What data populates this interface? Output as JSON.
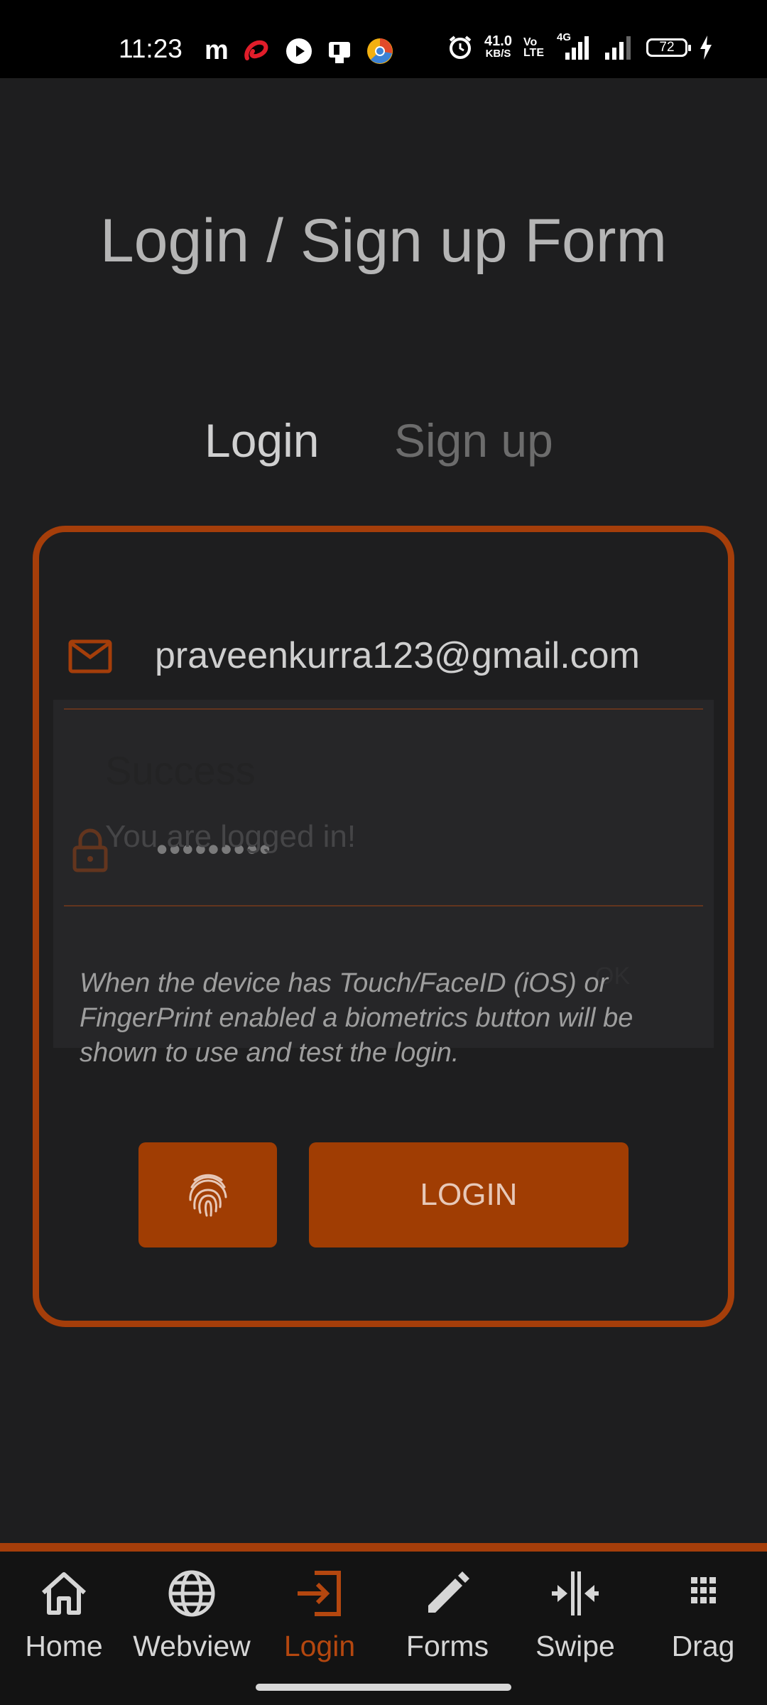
{
  "status_bar": {
    "time": "11:23",
    "net_speed_value": "41.0",
    "net_speed_unit": "KB/S",
    "volte_top": "Vo",
    "volte_bottom": "LTE",
    "network_type": "4G",
    "battery": "72",
    "left_icons": [
      "m-app-icon",
      "airtel-icon",
      "play-icon",
      "clipboard-icon",
      "chrome-like-icon"
    ],
    "right_icons": [
      "alarm-icon",
      "signal-icon",
      "charging-icon"
    ]
  },
  "page": {
    "title": "Login / Sign up Form"
  },
  "tabs": {
    "login": "Login",
    "signup": "Sign up"
  },
  "form": {
    "email": "praveenkurra123@gmail.com",
    "password_masked": "•••••••••",
    "hint": "When the device has Touch/FaceID (iOS) or FingerPrint enabled a biometrics button will be shown to use and test the login.",
    "login_button": "LOGIN"
  },
  "dialog": {
    "title": "Success",
    "message": "You are logged in!",
    "ok": "OK"
  },
  "colors": {
    "accent": "#a53e0a",
    "button": "#a03d03",
    "background": "#1e1e1f",
    "nav_active": "#b4470f"
  },
  "nav": {
    "items": [
      {
        "label": "Home",
        "icon": "home-icon"
      },
      {
        "label": "Webview",
        "icon": "globe-icon"
      },
      {
        "label": "Login",
        "icon": "login-icon",
        "active": true
      },
      {
        "label": "Forms",
        "icon": "pencil-icon"
      },
      {
        "label": "Swipe",
        "icon": "swipe-icon"
      },
      {
        "label": "Drag",
        "icon": "grid-icon"
      }
    ]
  }
}
